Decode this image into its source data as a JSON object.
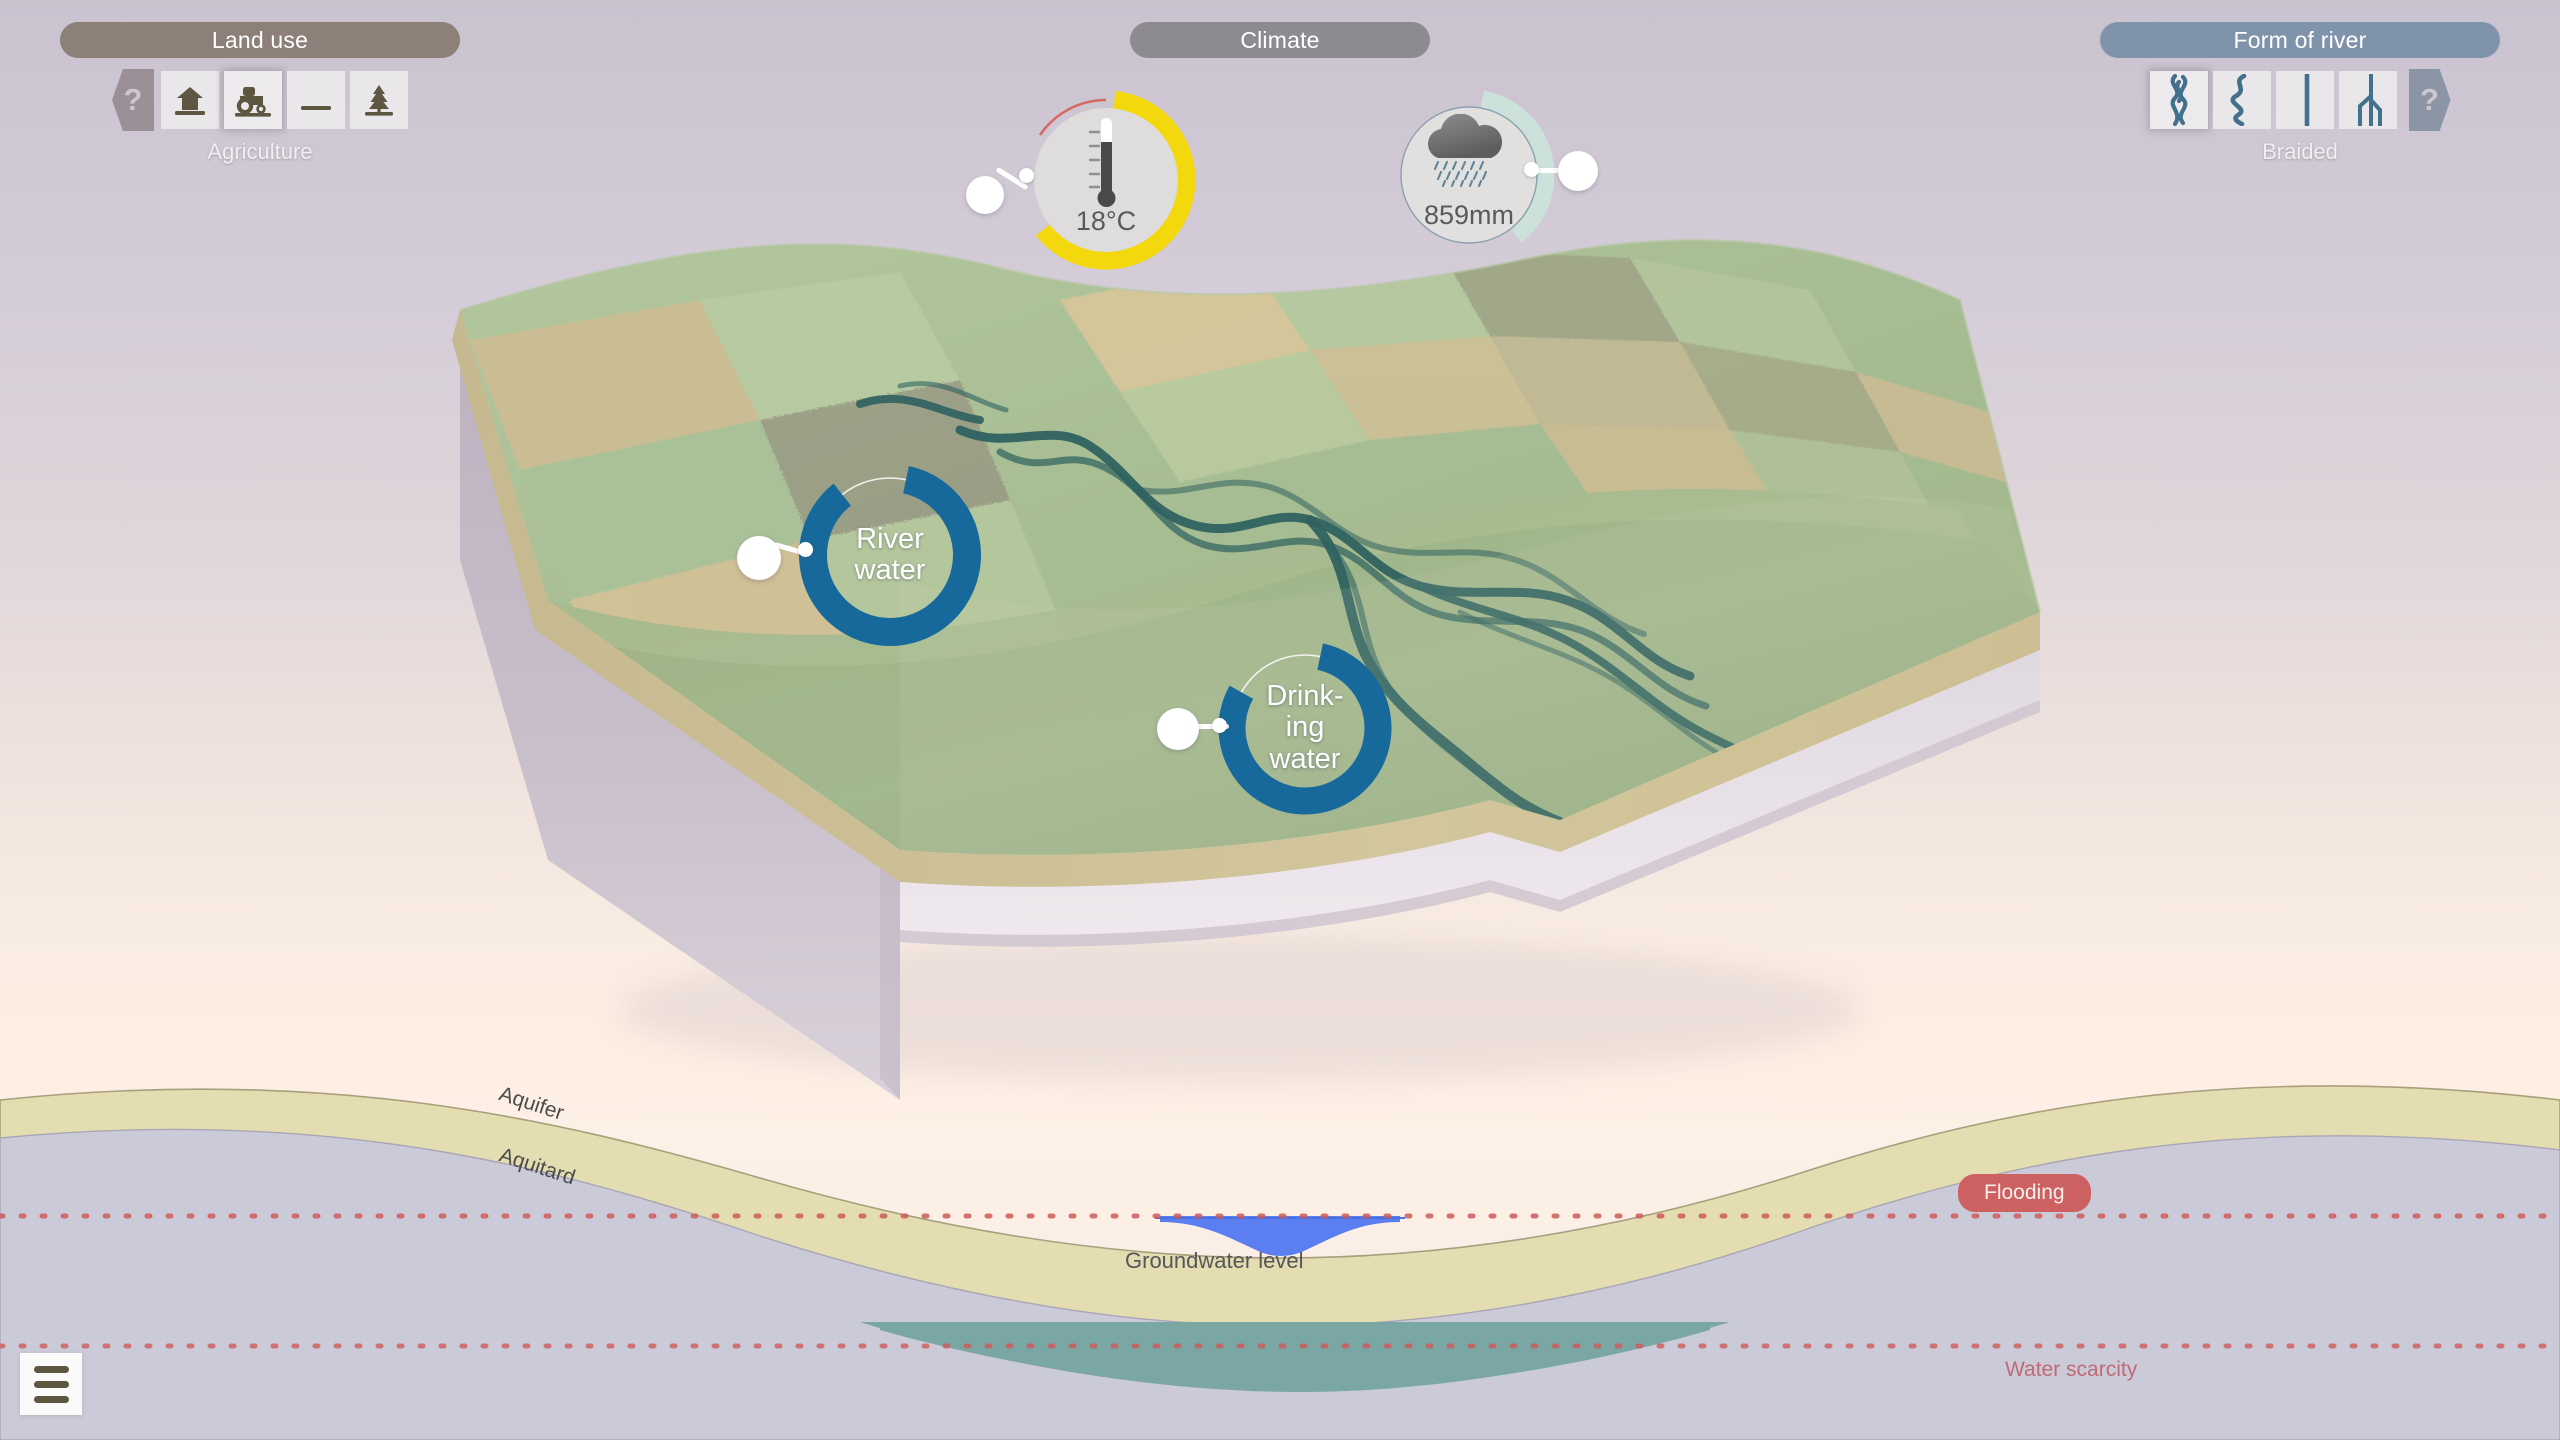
{
  "panels": {
    "land_use": {
      "title": "Land use",
      "selected_label": "Agriculture",
      "help_glyph": "?",
      "options": [
        {
          "id": "settlement",
          "icon": "house-icon",
          "selected": false
        },
        {
          "id": "agriculture",
          "icon": "tractor-icon",
          "selected": true
        },
        {
          "id": "bare",
          "icon": "bare-ground-icon",
          "selected": false
        },
        {
          "id": "forest",
          "icon": "tree-icon",
          "selected": false
        }
      ]
    },
    "climate": {
      "title": "Climate",
      "temperature": {
        "value": "18°C",
        "icon": "thermometer-icon",
        "arc_color": "#f2d80d",
        "arc_percent": 62
      },
      "precipitation": {
        "value": "859mm",
        "icon": "rain-cloud-icon",
        "arc_color": "#cbe1da",
        "arc_percent": 38
      }
    },
    "form_of_river": {
      "title": "Form of river",
      "selected_label": "Braided",
      "help_glyph": "?",
      "options": [
        {
          "id": "braided",
          "icon": "braided-river-icon",
          "selected": true
        },
        {
          "id": "meandering",
          "icon": "meandering-river-icon",
          "selected": false
        },
        {
          "id": "straight",
          "icon": "straight-river-icon",
          "selected": false
        },
        {
          "id": "anastomosing",
          "icon": "anastomosing-river-icon",
          "selected": false
        }
      ]
    }
  },
  "usage_dials": [
    {
      "id": "river-water",
      "line1": "River",
      "line2": "water",
      "ring_color": "#17699b",
      "percent": 86
    },
    {
      "id": "drinking-water",
      "line1": "Drink-",
      "line2": "ing",
      "line3": "water",
      "ring_color": "#17699b",
      "percent": 80
    }
  ],
  "cross_section": {
    "aquifer_label": "Aquifer",
    "aquitard_label": "Aquitard",
    "groundwater_label": "Groundwater level",
    "flooding_badge": "Flooding",
    "water_scarcity_label": "Water scarcity",
    "colors": {
      "aquifer": "#e4ddb1",
      "aquitard": "#cbcad8",
      "groundwater": "#5b7ef0",
      "deep_water": "#7aa6a3",
      "threshold_line": "#cf5b5b"
    }
  },
  "menu": {
    "icon": "hamburger-menu-icon",
    "label": "Menu"
  },
  "terrain": {
    "land_colors": {
      "grass": "#a9c199",
      "grass_light": "#bfd0a6",
      "field_tan": "#d8c79b",
      "field_sand": "#dcc79e",
      "floodplain": "#9fb284",
      "river": "#2b5e5c",
      "soil_edge": "#cbbd93",
      "side_wall": "#bdb0c1"
    }
  }
}
